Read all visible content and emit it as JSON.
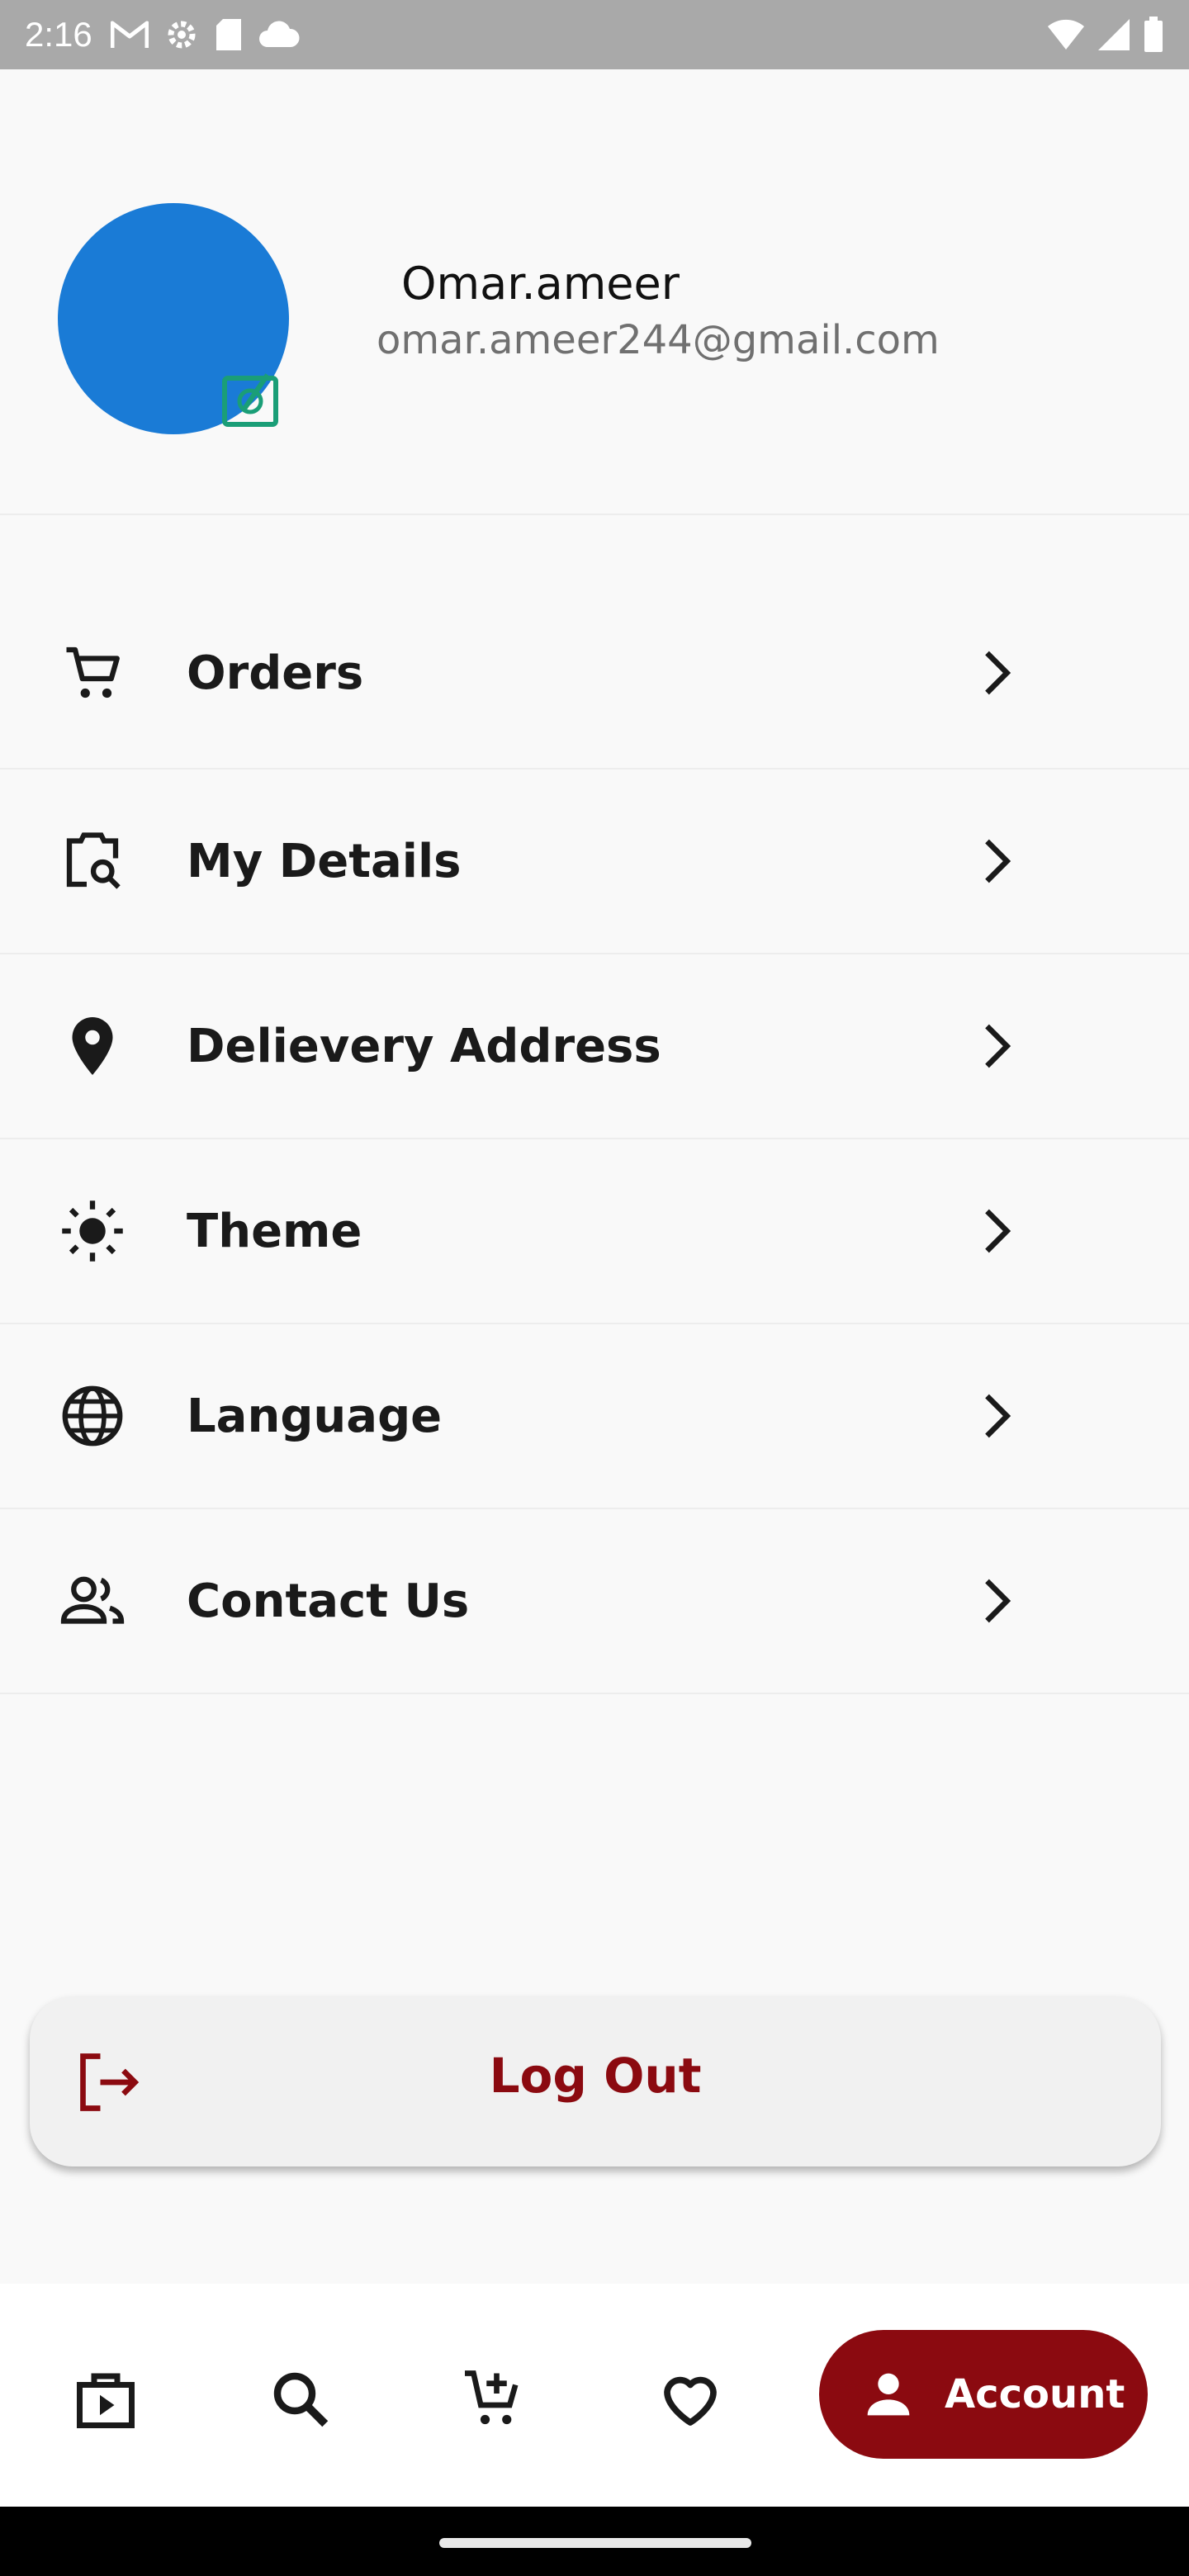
{
  "status_bar": {
    "time": "2:16",
    "icons": [
      "gmail-icon",
      "settings-icon",
      "sd-card-icon",
      "cloud-icon",
      "wifi-icon",
      "signal-icon",
      "battery-icon"
    ]
  },
  "profile": {
    "name": "Omar.ameer",
    "email": "omar.ameer244@gmail.com",
    "avatar_color": "#1a7bd6",
    "edit_icon": "camera-edit-icon",
    "edit_icon_color": "#1a9e77"
  },
  "menu": {
    "items": [
      {
        "label": "Orders",
        "icon": "cart-icon"
      },
      {
        "label": "My Details",
        "icon": "details-icon"
      },
      {
        "label": "Delievery Address",
        "icon": "location-pin-icon"
      },
      {
        "label": "Theme",
        "icon": "sun-icon"
      },
      {
        "label": "Language",
        "icon": "globe-icon"
      },
      {
        "label": "Contact Us",
        "icon": "people-icon"
      }
    ]
  },
  "logout": {
    "label": "Log Out",
    "icon": "logout-icon",
    "color": "#8b0a10"
  },
  "bottom_nav": {
    "items": [
      {
        "icon": "shop-icon"
      },
      {
        "icon": "search-icon"
      },
      {
        "icon": "cart-add-icon"
      },
      {
        "icon": "heart-icon"
      }
    ],
    "active": {
      "label": "Account",
      "icon": "person-icon"
    },
    "accent": "#8b0a10"
  }
}
